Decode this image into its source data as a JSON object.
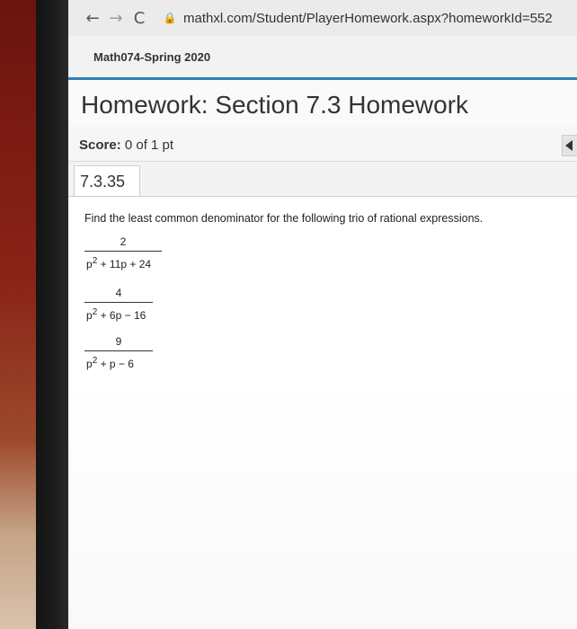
{
  "browser": {
    "back_icon": "←",
    "forward_icon": "→",
    "reload_icon": "C",
    "lock_icon": "🔒",
    "url": "mathxl.com/Student/PlayerHomework.aspx?homeworkId=552"
  },
  "course": {
    "title": "Math074-Spring 2020"
  },
  "homework": {
    "title": "Homework: Section 7.3 Homework"
  },
  "score": {
    "label": "Score:",
    "value": "0 of 1 pt"
  },
  "problem": {
    "number": "7.3.35",
    "instructions": "Find the least common denominator for the following trio of rational expressions.",
    "expressions": [
      {
        "numerator": "2",
        "denom_base": "p",
        "denom_exp": "2",
        "denom_rest": " + 11p + 24"
      },
      {
        "numerator": "4",
        "denom_base": "p",
        "denom_exp": "2",
        "denom_rest": " + 6p − 16"
      },
      {
        "numerator": "9",
        "denom_base": "p",
        "denom_exp": "2",
        "denom_rest": " + p − 6"
      }
    ]
  },
  "colors": {
    "accent": "#2f7fb5"
  }
}
